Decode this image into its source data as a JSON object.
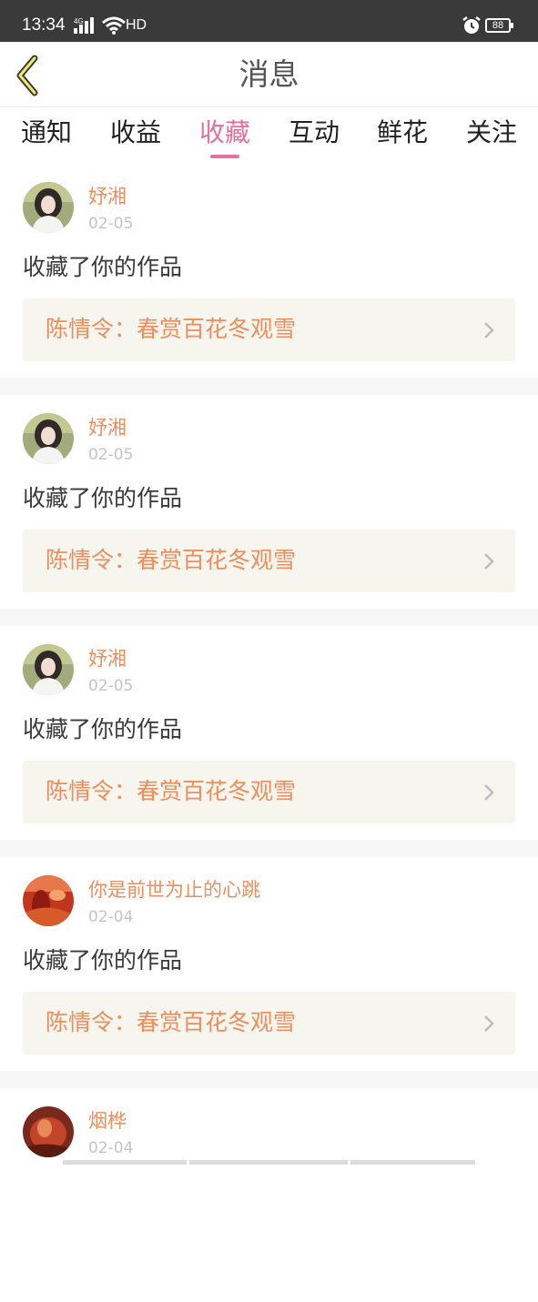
{
  "status_bar": {
    "time": "13:34",
    "network_tag": "4G",
    "hd_label": "HD",
    "battery": "88"
  },
  "header": {
    "title": "消息",
    "back_icon": "chevron-left-icon",
    "accent_color": "#e6709c"
  },
  "tabs": [
    {
      "label": "通知",
      "active": false
    },
    {
      "label": "收益",
      "active": false
    },
    {
      "label": "收藏",
      "active": true
    },
    {
      "label": "互动",
      "active": false
    },
    {
      "label": "鲜花",
      "active": false
    },
    {
      "label": "关注",
      "active": false
    }
  ],
  "feed": [
    {
      "user": "妤湘",
      "date": "02-05",
      "action": "收藏了你的作品",
      "work": "陈情令：春赏百花冬观雪"
    },
    {
      "user": "妤湘",
      "date": "02-05",
      "action": "收藏了你的作品",
      "work": "陈情令：春赏百花冬观雪"
    },
    {
      "user": "妤湘",
      "date": "02-05",
      "action": "收藏了你的作品",
      "work": "陈情令：春赏百花冬观雪"
    },
    {
      "user": "你是前世为止的心跳",
      "date": "02-04",
      "action": "收藏了你的作品",
      "work": "陈情令：春赏百花冬观雪"
    },
    {
      "user": "烟桦",
      "date": "02-04",
      "action": "",
      "work": ""
    }
  ]
}
